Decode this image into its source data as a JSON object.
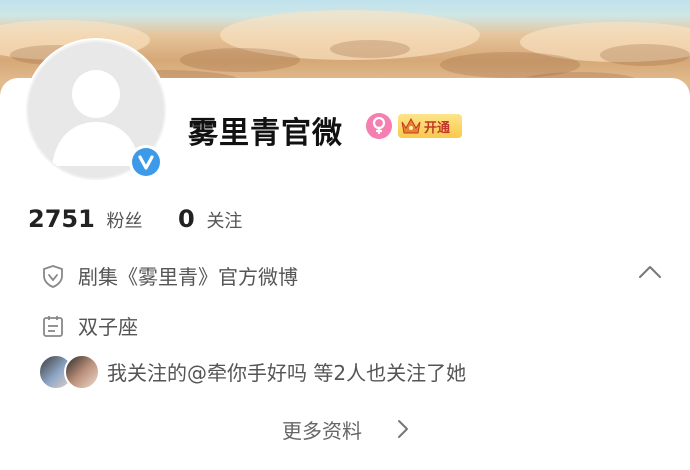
{
  "profile": {
    "name": "雾里青官微"
  },
  "badges": {
    "vip_label": "开通"
  },
  "stats": {
    "followers_count": "2751",
    "followers_label": "粉丝",
    "following_count": "0",
    "following_label": "关注"
  },
  "details": {
    "verification": "剧集《雾里青》官方微博",
    "constellation": "双子座"
  },
  "mutual": {
    "text": "我关注的@牵你手好吗 等2人也关注了她"
  },
  "more_info_label": "更多资料",
  "colors": {
    "verify_badge": "#3d9ae8",
    "gender_badge": "#f47fb0",
    "vip_badge": "#f8c94b",
    "vip_text": "#c0392b"
  },
  "icons": {
    "verified": "verified-v-icon",
    "gender": "female-icon",
    "vip": "crown-icon",
    "verification_row": "shield-check-icon",
    "constellation_row": "calendar-icon",
    "collapse": "chevron-up-icon",
    "more": "chevron-right-icon"
  }
}
